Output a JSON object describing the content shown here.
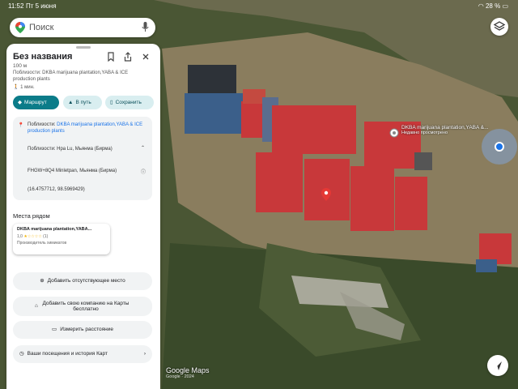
{
  "status_bar": {
    "time": "11:52",
    "date": "Пт 5 июня",
    "battery": "28 %"
  },
  "search": {
    "placeholder": "Поиск"
  },
  "panel": {
    "title": "Без названия",
    "distance": "100 м",
    "nearby_prefix": "Поблизости: ",
    "nearby_places": "DKBA marijuana plantation,YABA & ICE production plants",
    "walk_time": "1 мин.",
    "route_label": "Маршрут",
    "go_label": "В путь",
    "save_label": "Сохранить",
    "info": {
      "nearby_prefix": "Поблизости: ",
      "nearby_places": "DKBA marijuana plantation,YABA & ICE production plants",
      "region": "Поблизости: Нра Lu, Мьянма (Бирма)",
      "plus_code": "FHGW+8Q4 Minletpan, Мьянма (Бирма)",
      "coordinates": "(16.4757712, 98.5969429)"
    },
    "places_nearby_title": "Места рядом",
    "place_card": {
      "name": "DKBA marijuana plantation,YABA...",
      "rating": "1,0",
      "reviews": "(1)",
      "type": "Производитель химикатов"
    },
    "actions": [
      {
        "label": "Добавить отсутствующее место"
      },
      {
        "label": "Добавить свою компанию на Карты бесплатно"
      },
      {
        "label": "Измерить расстояние"
      },
      {
        "label": "Ваши посещения и история Карт"
      }
    ]
  },
  "map": {
    "place_label": "DKBA marijuana plantation,YABA &...",
    "place_sublabel": "Недавно просмотрено",
    "logo": "Google Maps",
    "copyright": "Google · 2024"
  },
  "colors": {
    "accent": "#0b7c89",
    "roof_red": "#c8383a",
    "roof_blue": "#3b5f8a"
  }
}
